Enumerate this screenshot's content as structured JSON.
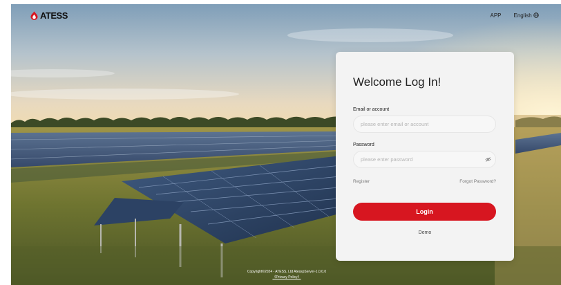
{
  "brand": {
    "name": "ATESS",
    "accent": "#d71620"
  },
  "topnav": {
    "app": "APP",
    "language": "English",
    "language_icon": "globe-icon"
  },
  "login": {
    "title": "Welcome Log In!",
    "email_label": "Email or account",
    "email_placeholder": "please enter email or account",
    "password_label": "Password",
    "password_placeholder": "please enter password",
    "password_toggle_icon": "eye-off-icon",
    "register": "Register",
    "forgot": "Forgot Password?",
    "login_button": "Login",
    "demo": "Demo"
  },
  "footer": {
    "copyright": "Copyright©2024 - ATESS, Ltd AtesspServer-1.0.0.0",
    "privacy": "《Privacy Policy》"
  }
}
